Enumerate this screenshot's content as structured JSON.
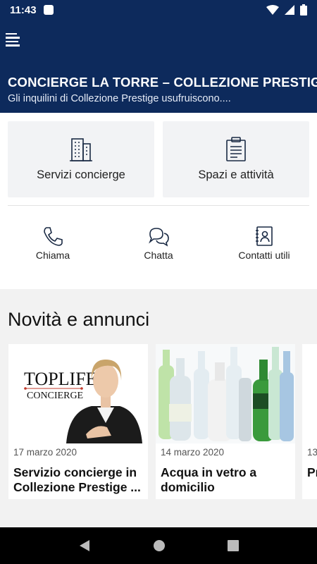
{
  "statusbar": {
    "time": "11:43"
  },
  "header": {
    "title": "CONCIERGE LA TORRE – COLLEZIONE PRESTIGE",
    "subtitle": "Gli inquilini di Collezione Prestige usufruiscono...."
  },
  "cards": [
    {
      "label": "Servizi concierge",
      "icon": "building-icon"
    },
    {
      "label": "Spazi e attività",
      "icon": "clipboard-icon"
    }
  ],
  "quick_actions": [
    {
      "label": "Chiama",
      "icon": "phone-icon"
    },
    {
      "label": "Chatta",
      "icon": "chat-icon"
    },
    {
      "label": "Contatti utili",
      "icon": "contacts-icon"
    }
  ],
  "news": {
    "title": "Novità e annunci",
    "items": [
      {
        "date": "17 marzo 2020",
        "headline": "Servizio concierge in Collezione Prestige ...",
        "logo_line1": "TOPLIFE",
        "logo_line2": "CONCIERGE"
      },
      {
        "date": "14 marzo 2020",
        "headline": "Acqua in vetro a domicilio"
      },
      {
        "date": "13",
        "headline": "Pr in"
      }
    ]
  },
  "colors": {
    "header_bg": "#0d2a5c",
    "card_bg": "#f2f3f5"
  }
}
